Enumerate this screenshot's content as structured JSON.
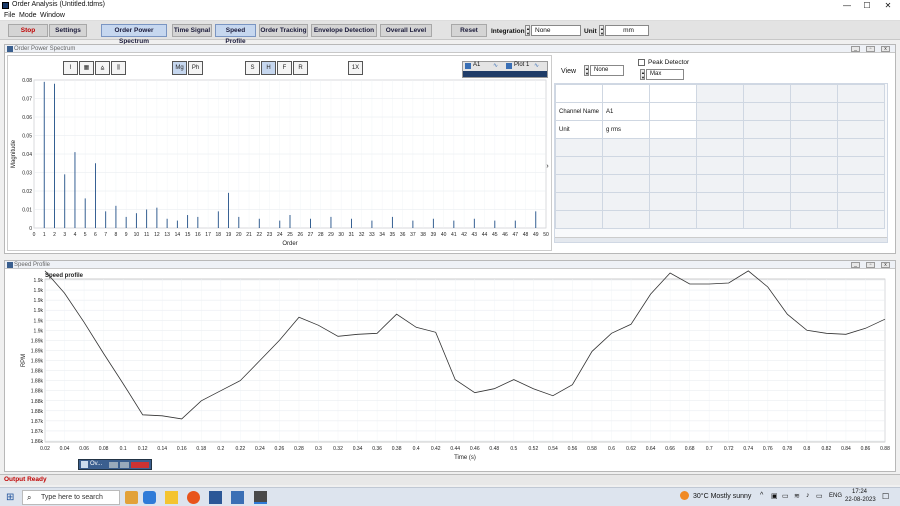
{
  "window": {
    "title": "Order Analysis (Untitled.tdms)",
    "minimize": "—",
    "maximize": "☐",
    "close": "✕"
  },
  "menu": [
    "File",
    "Mode",
    "Window"
  ],
  "toolbar": {
    "stop": "Stop",
    "settings": "Settings",
    "order_power_spectrum": "Order Power Spectrum",
    "time_signal": "Time Signal",
    "speed_profile": "Speed Profile",
    "order_tracking": "Order Tracking",
    "envelope_detection": "Envelope Detection",
    "overall_level": "Overall Level",
    "reset": "Reset",
    "integration_label": "Integration",
    "integration_value": "None",
    "unit_label": "Unit",
    "unit_value": "mm"
  },
  "pane1": {
    "title": "Order Power Spectrum",
    "view_label": "View",
    "view_value": "None",
    "peak_detector_label": "Peak Detector",
    "peak_value": "Max",
    "legend_a1": "A1",
    "legend_plot1": "Plot 1",
    "table": [
      [
        "",
        ""
      ],
      [
        "Channel Name",
        "A1"
      ],
      [
        "Unit",
        "g rms"
      ]
    ]
  },
  "pane2": {
    "title": "Speed Profile",
    "mini_window": "Ov..."
  },
  "chart_data": [
    {
      "type": "bar",
      "title": "",
      "xlabel": "Order",
      "ylabel": "Magnitude",
      "xlim": [
        0,
        50
      ],
      "ylim": [
        0,
        0.08
      ],
      "xticks": [
        "0",
        "1",
        "2",
        "3",
        "4",
        "5",
        "6",
        "7",
        "8",
        "9",
        "10",
        "11",
        "12",
        "13",
        "14",
        "15",
        "16",
        "17",
        "18",
        "19",
        "20",
        "21",
        "22",
        "23",
        "24",
        "25",
        "26",
        "27",
        "28",
        "29",
        "30",
        "31",
        "32",
        "33",
        "34",
        "35",
        "36",
        "37",
        "38",
        "39",
        "40",
        "41",
        "42",
        "43",
        "44",
        "45",
        "46",
        "47",
        "48",
        "49",
        "50"
      ],
      "yticks": [
        "0",
        "0.01",
        "0.02",
        "0.03",
        "0.04",
        "0.05",
        "0.06",
        "0.07",
        "0.08"
      ],
      "peaks": [
        {
          "x": 1,
          "y": 0.079
        },
        {
          "x": 2,
          "y": 0.078
        },
        {
          "x": 3,
          "y": 0.029
        },
        {
          "x": 4,
          "y": 0.041
        },
        {
          "x": 5,
          "y": 0.016
        },
        {
          "x": 6,
          "y": 0.035
        },
        {
          "x": 7,
          "y": 0.009
        },
        {
          "x": 8,
          "y": 0.012
        },
        {
          "x": 9,
          "y": 0.006
        },
        {
          "x": 10,
          "y": 0.008
        },
        {
          "x": 11,
          "y": 0.01
        },
        {
          "x": 12,
          "y": 0.011
        },
        {
          "x": 13,
          "y": 0.005
        },
        {
          "x": 14,
          "y": 0.004
        },
        {
          "x": 15,
          "y": 0.007
        },
        {
          "x": 16,
          "y": 0.006
        },
        {
          "x": 18,
          "y": 0.009
        },
        {
          "x": 19,
          "y": 0.019
        },
        {
          "x": 20,
          "y": 0.006
        },
        {
          "x": 22,
          "y": 0.005
        },
        {
          "x": 24,
          "y": 0.004
        },
        {
          "x": 25,
          "y": 0.007
        },
        {
          "x": 27,
          "y": 0.005
        },
        {
          "x": 29,
          "y": 0.006
        },
        {
          "x": 31,
          "y": 0.005
        },
        {
          "x": 33,
          "y": 0.004
        },
        {
          "x": 35,
          "y": 0.006
        },
        {
          "x": 37,
          "y": 0.004
        },
        {
          "x": 39,
          "y": 0.005
        },
        {
          "x": 41,
          "y": 0.004
        },
        {
          "x": 43,
          "y": 0.005
        },
        {
          "x": 45,
          "y": 0.004
        },
        {
          "x": 47,
          "y": 0.004
        },
        {
          "x": 49,
          "y": 0.009
        }
      ]
    },
    {
      "type": "line",
      "title": "Speed profile",
      "xlabel": "Time (s)",
      "ylabel": "RPM",
      "xlim": [
        0.02,
        0.88
      ],
      "xticks": [
        "0.02",
        "0.04",
        "0.06",
        "0.08",
        "0.1",
        "0.12",
        "0.14",
        "0.16",
        "0.18",
        "0.2",
        "0.22",
        "0.24",
        "0.26",
        "0.28",
        "0.3",
        "0.32",
        "0.34",
        "0.36",
        "0.38",
        "0.4",
        "0.42",
        "0.44",
        "0.46",
        "0.48",
        "0.5",
        "0.52",
        "0.54",
        "0.56",
        "0.58",
        "0.6",
        "0.62",
        "0.64",
        "0.66",
        "0.68",
        "0.7",
        "0.72",
        "0.74",
        "0.76",
        "0.78",
        "0.8",
        "0.82",
        "0.84",
        "0.86",
        "0.88"
      ],
      "yticks": [
        "1.9k",
        "1.9k",
        "1.9k",
        "1.9k",
        "1.9k",
        "1.9k",
        "1.89k",
        "1.89k",
        "1.89k",
        "1.88k",
        "1.88k",
        "1.88k",
        "1.88k",
        "1.88k",
        "1.87k",
        "1.87k",
        "1.86k"
      ],
      "points": [
        [
          0.02,
          16.9
        ],
        [
          0.04,
          14.7
        ],
        [
          0.06,
          11.8
        ],
        [
          0.08,
          8.7
        ],
        [
          0.1,
          5.7
        ],
        [
          0.12,
          2.6
        ],
        [
          0.14,
          2.5
        ],
        [
          0.16,
          2.2
        ],
        [
          0.18,
          4.0
        ],
        [
          0.2,
          5.0
        ],
        [
          0.22,
          6.0
        ],
        [
          0.24,
          8.0
        ],
        [
          0.26,
          10.0
        ],
        [
          0.28,
          12.3
        ],
        [
          0.3,
          11.5
        ],
        [
          0.32,
          10.4
        ],
        [
          0.34,
          10.6
        ],
        [
          0.36,
          10.7
        ],
        [
          0.38,
          12.6
        ],
        [
          0.4,
          11.3
        ],
        [
          0.42,
          10.8
        ],
        [
          0.44,
          6.1
        ],
        [
          0.46,
          4.8
        ],
        [
          0.48,
          5.2
        ],
        [
          0.5,
          6.1
        ],
        [
          0.52,
          5.2
        ],
        [
          0.54,
          4.5
        ],
        [
          0.56,
          5.6
        ],
        [
          0.58,
          8.9
        ],
        [
          0.6,
          10.7
        ],
        [
          0.62,
          11.6
        ],
        [
          0.64,
          14.6
        ],
        [
          0.66,
          16.7
        ],
        [
          0.68,
          15.6
        ],
        [
          0.7,
          15.6
        ],
        [
          0.72,
          15.7
        ],
        [
          0.74,
          16.9
        ],
        [
          0.76,
          15.3
        ],
        [
          0.78,
          12.6
        ],
        [
          0.8,
          11.0
        ],
        [
          0.82,
          10.7
        ],
        [
          0.84,
          10.6
        ],
        [
          0.86,
          11.2
        ],
        [
          0.88,
          12.1
        ]
      ]
    }
  ],
  "status": "Output Ready",
  "taskbar": {
    "search": "Type here to search",
    "weather": "30°C  Mostly sunny",
    "lang": "ENG",
    "time": "17:24",
    "date": "22-08-2023"
  }
}
